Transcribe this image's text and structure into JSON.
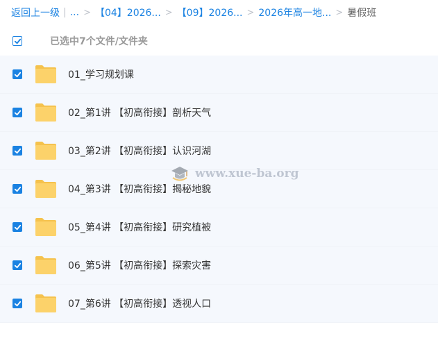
{
  "breadcrumb": {
    "back_label": "返回上一级",
    "ellipsis": "...",
    "items": [
      "【04】2026...",
      "【09】2026...",
      "2026年高一地...",
      "暑假班"
    ]
  },
  "selection": {
    "text": "已选中7个文件/文件夹"
  },
  "files": [
    {
      "name": "01_学习规划课",
      "checked": true
    },
    {
      "name": "02_第1讲 【初高衔接】剖析天气",
      "checked": true
    },
    {
      "name": "03_第2讲 【初高衔接】认识河湖",
      "checked": true
    },
    {
      "name": "04_第3讲 【初高衔接】揭秘地貌",
      "checked": true
    },
    {
      "name": "05_第4讲 【初高衔接】研究植被",
      "checked": true
    },
    {
      "name": "06_第5讲 【初高衔接】探索灾害",
      "checked": true
    },
    {
      "name": "07_第6讲 【初高衔接】透视人口",
      "checked": true
    }
  ],
  "watermark": {
    "text": "www.xue-ba.org"
  },
  "colors": {
    "accent": "#1a82e2",
    "folder": "#fcd26a",
    "row_bg": "#f5f8fd"
  }
}
